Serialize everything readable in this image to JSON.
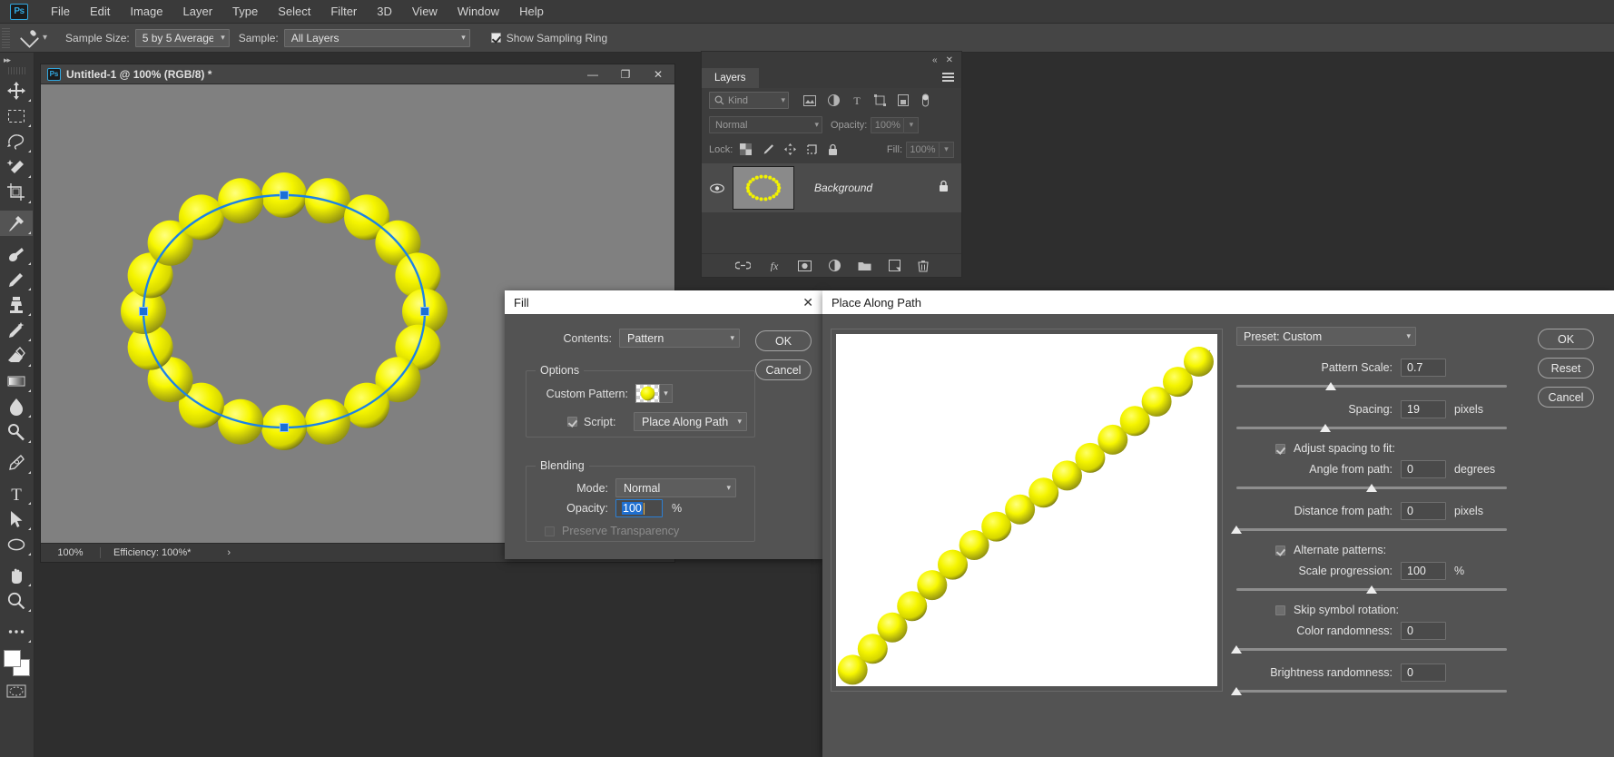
{
  "app": {
    "logo": "Ps"
  },
  "menubar": {
    "items": [
      "File",
      "Edit",
      "Image",
      "Layer",
      "Type",
      "Select",
      "Filter",
      "3D",
      "View",
      "Window",
      "Help"
    ]
  },
  "options_bar": {
    "tool_icon": "eyedropper-icon",
    "sample_size_label": "Sample Size:",
    "sample_size_value": "5 by 5 Average",
    "sample_label": "Sample:",
    "sample_value": "All Layers",
    "show_sampling_ring_label": "Show Sampling Ring",
    "show_sampling_ring_checked": true
  },
  "toolbar": {
    "tools": [
      {
        "name": "move-tool",
        "selected": false
      },
      {
        "name": "rectangular-marquee-tool",
        "selected": false
      },
      {
        "name": "lasso-tool",
        "selected": false
      },
      {
        "name": "quick-selection-tool",
        "selected": false
      },
      {
        "name": "crop-tool",
        "selected": false
      },
      {
        "name": "eyedropper-tool",
        "selected": true
      },
      {
        "name": "spot-healing-brush-tool",
        "selected": false
      },
      {
        "name": "brush-tool",
        "selected": false
      },
      {
        "name": "clone-stamp-tool",
        "selected": false
      },
      {
        "name": "history-brush-tool",
        "selected": false
      },
      {
        "name": "eraser-tool",
        "selected": false
      },
      {
        "name": "gradient-tool",
        "selected": false
      },
      {
        "name": "blur-tool",
        "selected": false
      },
      {
        "name": "dodge-tool",
        "selected": false
      },
      {
        "name": "pen-tool",
        "selected": false
      },
      {
        "name": "type-tool",
        "selected": false
      },
      {
        "name": "path-selection-tool",
        "selected": false
      },
      {
        "name": "ellipse-tool",
        "selected": false
      },
      {
        "name": "hand-tool",
        "selected": false
      },
      {
        "name": "zoom-tool",
        "selected": false
      },
      {
        "name": "edit-toolbar-tool",
        "selected": false
      }
    ],
    "foreground_color": "#ffffff",
    "background_color": "#ffffff"
  },
  "document": {
    "title": "Untitled-1 @ 100% (RGB/8) *",
    "zoom": "100%",
    "efficiency": "Efficiency: 100%*",
    "canvas_bg": "#808080",
    "path_color": "#1b82e6",
    "sphere_color": "#f2f213",
    "sphere_count": 20,
    "minimize": "—",
    "maximize": "❐",
    "close": "✕"
  },
  "layers_panel": {
    "title": "Layers",
    "collapse": "«",
    "close": "✕",
    "filter_placeholder": "Kind",
    "blend_mode": "Normal",
    "opacity_label": "Opacity:",
    "opacity_value": "100%",
    "lock_label": "Lock:",
    "fill_label": "Fill:",
    "fill_value": "100%",
    "layer": {
      "name": "Background",
      "visible": true,
      "locked": true
    },
    "filter_icons": [
      "pixel-filter-icon",
      "adjustment-filter-icon",
      "type-filter-icon",
      "shape-filter-icon",
      "smart-object-filter-icon",
      "toggle-filter-icon"
    ],
    "lock_icons": [
      "lock-transparent-pixels-icon",
      "lock-image-pixels-icon",
      "lock-position-icon",
      "lock-artboard-icon",
      "lock-all-icon"
    ],
    "bottom_icons": [
      "link-layers-icon",
      "layer-style-icon",
      "layer-mask-icon",
      "adjustment-layer-icon",
      "new-group-icon",
      "new-layer-icon",
      "delete-layer-icon"
    ]
  },
  "fill_dialog": {
    "title": "Fill",
    "close": "✕",
    "contents_label": "Contents:",
    "contents_value": "Pattern",
    "ok_label": "OK",
    "cancel_label": "Cancel",
    "options_group": "Options",
    "custom_pattern_label": "Custom Pattern:",
    "script_label": "Script:",
    "script_checked": true,
    "script_value": "Place Along Path",
    "blending_group": "Blending",
    "mode_label": "Mode:",
    "mode_value": "Normal",
    "opacity_label": "Opacity:",
    "opacity_value": "100",
    "opacity_unit": "%",
    "preserve_transparency_label": "Preserve Transparency",
    "preserve_transparency_checked": false,
    "preserve_transparency_enabled": false
  },
  "place_along_path": {
    "title": "Place Along Path",
    "preset_label": "Preset: Custom",
    "ok_label": "OK",
    "reset_label": "Reset",
    "cancel_label": "Cancel",
    "controls": [
      {
        "name": "pattern-scale",
        "label": "Pattern Scale:",
        "value": "0.7",
        "unit": "",
        "slider": 35
      },
      {
        "name": "spacing",
        "label": "Spacing:",
        "value": "19",
        "unit": "pixels",
        "slider": 33
      },
      {
        "name": "angle-from-path",
        "label": "Angle from path:",
        "value": "0",
        "unit": "degrees",
        "slider": 50
      },
      {
        "name": "distance-from-path",
        "label": "Distance from path:",
        "value": "0",
        "unit": "pixels",
        "slider": 0
      },
      {
        "name": "scale-progression",
        "label": "Scale progression:",
        "value": "100",
        "unit": "%",
        "slider": 50
      },
      {
        "name": "color-randomness",
        "label": "Color randomness:",
        "value": "0",
        "unit": "",
        "slider": 0
      },
      {
        "name": "brightness-randomness",
        "label": "Brightness randomness:",
        "value": "0",
        "unit": "",
        "slider": 0
      }
    ],
    "checkboxes": [
      {
        "name": "adjust-spacing-to-fit",
        "label": "Adjust spacing to fit:",
        "checked": true
      },
      {
        "name": "alternate-patterns",
        "label": "Alternate patterns:",
        "checked": true
      },
      {
        "name": "skip-symbol-rotation",
        "label": "Skip symbol rotation:",
        "checked": false
      }
    ],
    "preview_sphere_count": 17,
    "preview_bg": "#ffffff"
  }
}
